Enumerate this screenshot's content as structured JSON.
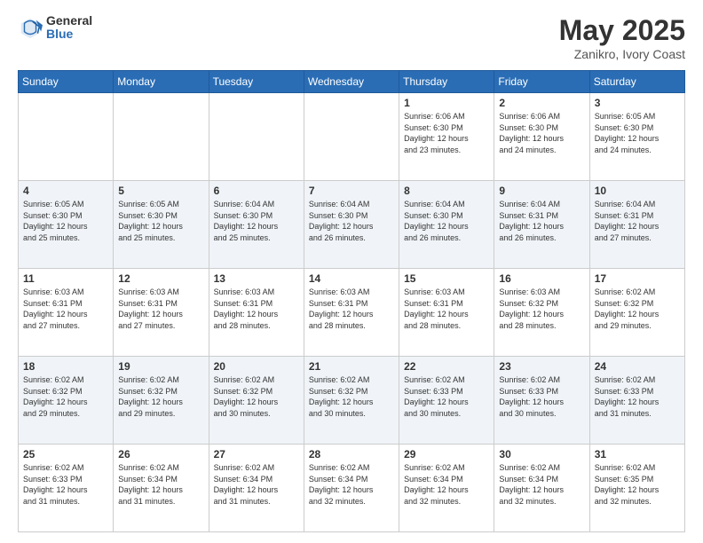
{
  "header": {
    "logo_general": "General",
    "logo_blue": "Blue",
    "month_year": "May 2025",
    "location": "Zanikro, Ivory Coast"
  },
  "days_of_week": [
    "Sunday",
    "Monday",
    "Tuesday",
    "Wednesday",
    "Thursday",
    "Friday",
    "Saturday"
  ],
  "weeks": [
    [
      {
        "day": "",
        "info": ""
      },
      {
        "day": "",
        "info": ""
      },
      {
        "day": "",
        "info": ""
      },
      {
        "day": "",
        "info": ""
      },
      {
        "day": "1",
        "info": "Sunrise: 6:06 AM\nSunset: 6:30 PM\nDaylight: 12 hours\nand 23 minutes."
      },
      {
        "day": "2",
        "info": "Sunrise: 6:06 AM\nSunset: 6:30 PM\nDaylight: 12 hours\nand 24 minutes."
      },
      {
        "day": "3",
        "info": "Sunrise: 6:05 AM\nSunset: 6:30 PM\nDaylight: 12 hours\nand 24 minutes."
      }
    ],
    [
      {
        "day": "4",
        "info": "Sunrise: 6:05 AM\nSunset: 6:30 PM\nDaylight: 12 hours\nand 25 minutes."
      },
      {
        "day": "5",
        "info": "Sunrise: 6:05 AM\nSunset: 6:30 PM\nDaylight: 12 hours\nand 25 minutes."
      },
      {
        "day": "6",
        "info": "Sunrise: 6:04 AM\nSunset: 6:30 PM\nDaylight: 12 hours\nand 25 minutes."
      },
      {
        "day": "7",
        "info": "Sunrise: 6:04 AM\nSunset: 6:30 PM\nDaylight: 12 hours\nand 26 minutes."
      },
      {
        "day": "8",
        "info": "Sunrise: 6:04 AM\nSunset: 6:30 PM\nDaylight: 12 hours\nand 26 minutes."
      },
      {
        "day": "9",
        "info": "Sunrise: 6:04 AM\nSunset: 6:31 PM\nDaylight: 12 hours\nand 26 minutes."
      },
      {
        "day": "10",
        "info": "Sunrise: 6:04 AM\nSunset: 6:31 PM\nDaylight: 12 hours\nand 27 minutes."
      }
    ],
    [
      {
        "day": "11",
        "info": "Sunrise: 6:03 AM\nSunset: 6:31 PM\nDaylight: 12 hours\nand 27 minutes."
      },
      {
        "day": "12",
        "info": "Sunrise: 6:03 AM\nSunset: 6:31 PM\nDaylight: 12 hours\nand 27 minutes."
      },
      {
        "day": "13",
        "info": "Sunrise: 6:03 AM\nSunset: 6:31 PM\nDaylight: 12 hours\nand 28 minutes."
      },
      {
        "day": "14",
        "info": "Sunrise: 6:03 AM\nSunset: 6:31 PM\nDaylight: 12 hours\nand 28 minutes."
      },
      {
        "day": "15",
        "info": "Sunrise: 6:03 AM\nSunset: 6:31 PM\nDaylight: 12 hours\nand 28 minutes."
      },
      {
        "day": "16",
        "info": "Sunrise: 6:03 AM\nSunset: 6:32 PM\nDaylight: 12 hours\nand 28 minutes."
      },
      {
        "day": "17",
        "info": "Sunrise: 6:02 AM\nSunset: 6:32 PM\nDaylight: 12 hours\nand 29 minutes."
      }
    ],
    [
      {
        "day": "18",
        "info": "Sunrise: 6:02 AM\nSunset: 6:32 PM\nDaylight: 12 hours\nand 29 minutes."
      },
      {
        "day": "19",
        "info": "Sunrise: 6:02 AM\nSunset: 6:32 PM\nDaylight: 12 hours\nand 29 minutes."
      },
      {
        "day": "20",
        "info": "Sunrise: 6:02 AM\nSunset: 6:32 PM\nDaylight: 12 hours\nand 30 minutes."
      },
      {
        "day": "21",
        "info": "Sunrise: 6:02 AM\nSunset: 6:32 PM\nDaylight: 12 hours\nand 30 minutes."
      },
      {
        "day": "22",
        "info": "Sunrise: 6:02 AM\nSunset: 6:33 PM\nDaylight: 12 hours\nand 30 minutes."
      },
      {
        "day": "23",
        "info": "Sunrise: 6:02 AM\nSunset: 6:33 PM\nDaylight: 12 hours\nand 30 minutes."
      },
      {
        "day": "24",
        "info": "Sunrise: 6:02 AM\nSunset: 6:33 PM\nDaylight: 12 hours\nand 31 minutes."
      }
    ],
    [
      {
        "day": "25",
        "info": "Sunrise: 6:02 AM\nSunset: 6:33 PM\nDaylight: 12 hours\nand 31 minutes."
      },
      {
        "day": "26",
        "info": "Sunrise: 6:02 AM\nSunset: 6:34 PM\nDaylight: 12 hours\nand 31 minutes."
      },
      {
        "day": "27",
        "info": "Sunrise: 6:02 AM\nSunset: 6:34 PM\nDaylight: 12 hours\nand 31 minutes."
      },
      {
        "day": "28",
        "info": "Sunrise: 6:02 AM\nSunset: 6:34 PM\nDaylight: 12 hours\nand 32 minutes."
      },
      {
        "day": "29",
        "info": "Sunrise: 6:02 AM\nSunset: 6:34 PM\nDaylight: 12 hours\nand 32 minutes."
      },
      {
        "day": "30",
        "info": "Sunrise: 6:02 AM\nSunset: 6:34 PM\nDaylight: 12 hours\nand 32 minutes."
      },
      {
        "day": "31",
        "info": "Sunrise: 6:02 AM\nSunset: 6:35 PM\nDaylight: 12 hours\nand 32 minutes."
      }
    ]
  ]
}
